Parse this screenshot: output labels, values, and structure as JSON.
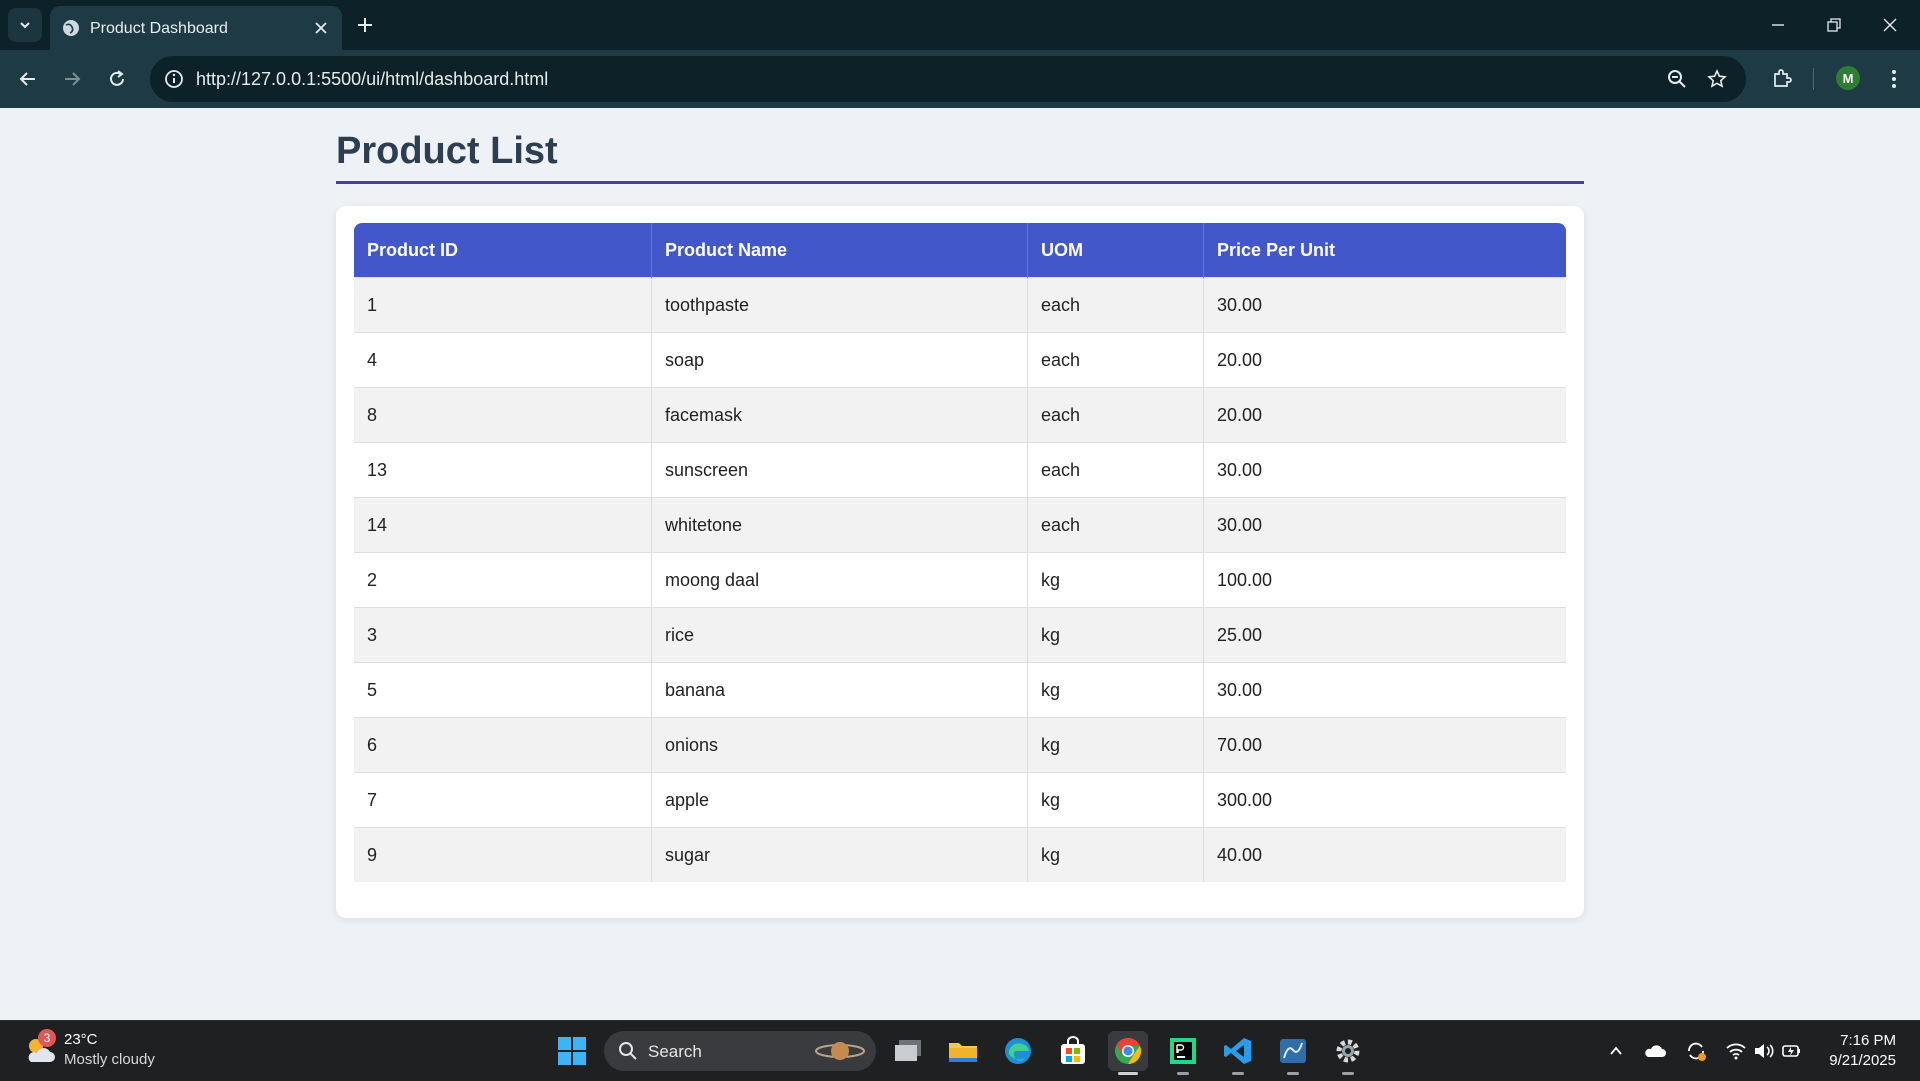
{
  "browser": {
    "tab_title": "Product Dashboard",
    "url": "http://127.0.0.1:5500/ui/html/dashboard.html",
    "profile_initial": "M"
  },
  "page": {
    "title": "Product List",
    "table": {
      "headers": [
        "Product ID",
        "Product Name",
        "UOM",
        "Price Per Unit"
      ],
      "rows": [
        [
          "1",
          "toothpaste",
          "each",
          "30.00"
        ],
        [
          "4",
          "soap",
          "each",
          "20.00"
        ],
        [
          "8",
          "facemask",
          "each",
          "20.00"
        ],
        [
          "13",
          "sunscreen",
          "each",
          "30.00"
        ],
        [
          "14",
          "whitetone",
          "each",
          "30.00"
        ],
        [
          "2",
          "moong daal",
          "kg",
          "100.00"
        ],
        [
          "3",
          "rice",
          "kg",
          "25.00"
        ],
        [
          "5",
          "banana",
          "kg",
          "30.00"
        ],
        [
          "6",
          "onions",
          "kg",
          "70.00"
        ],
        [
          "7",
          "apple",
          "kg",
          "300.00"
        ],
        [
          "9",
          "sugar",
          "kg",
          "40.00"
        ]
      ]
    }
  },
  "taskbar": {
    "weather_temp": "23°C",
    "weather_desc": "Mostly cloudy",
    "weather_badge": "3",
    "search_label": "Search",
    "clock_time": "7:16 PM",
    "clock_date": "9/21/2025"
  },
  "colors": {
    "header_bg": "#4257c9",
    "title_color": "#2c3e50",
    "title_underline": "#4b3fa6"
  }
}
